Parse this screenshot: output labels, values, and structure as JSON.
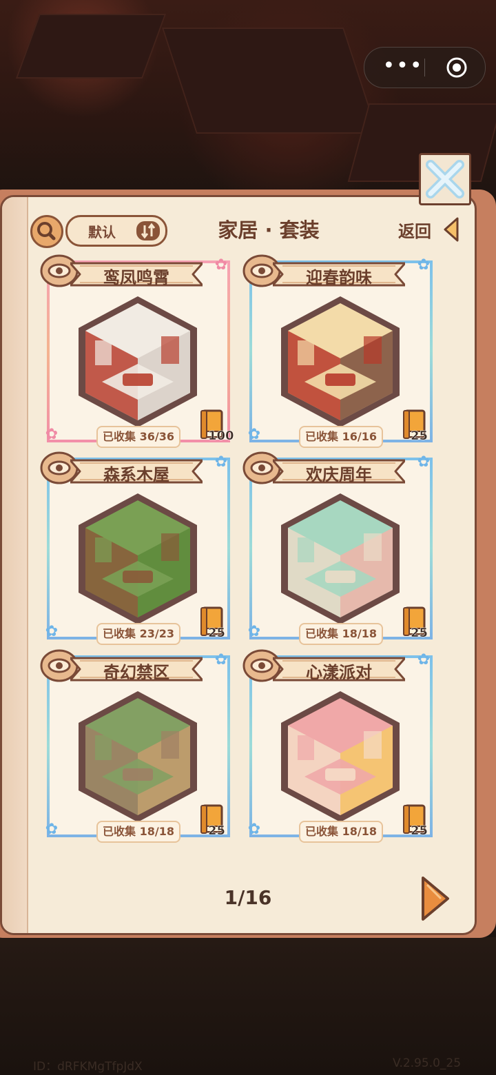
{
  "header": {
    "title": "家居 · 套装",
    "sort_label": "默认",
    "back_label": "返回"
  },
  "cards": [
    {
      "name": "鸾凤鸣霄",
      "collected": "已收集 36/36",
      "book_count": "100",
      "frame": "pink",
      "palette": [
        "#b8402f",
        "#f1ebe3",
        "#d8cfc7"
      ]
    },
    {
      "name": "迎春韵味",
      "collected": "已收集 16/16",
      "book_count": "25",
      "frame": "blue",
      "palette": [
        "#b73a2b",
        "#f3dba9",
        "#7a4e3c"
      ]
    },
    {
      "name": "森系木屋",
      "collected": "已收集 23/23",
      "book_count": "25",
      "frame": "blue",
      "palette": [
        "#8a5a39",
        "#7aa054",
        "#5d8a3b"
      ]
    },
    {
      "name": "欢庆周年",
      "collected": "已收集 18/18",
      "book_count": "25",
      "frame": "blue",
      "palette": [
        "#eadbc7",
        "#a7d7c0",
        "#f1b4a8"
      ]
    },
    {
      "name": "奇幻禁区",
      "collected": "已收集 18/18",
      "book_count": "25",
      "frame": "blue",
      "palette": [
        "#9f8064",
        "#83a063",
        "#c79b6d"
      ]
    },
    {
      "name": "心漾派对",
      "collected": "已收集 18/18",
      "book_count": "25",
      "frame": "blue",
      "palette": [
        "#f5dcc6",
        "#f0a8a8",
        "#f6c96a"
      ]
    }
  ],
  "pagination": {
    "current_label": "1/16"
  },
  "footer": {
    "id_text": "ID：dRFKMgTfpJdX",
    "version_text": "V.2.95.0_25"
  },
  "colors": {
    "panel_bg": "#f6ebd8",
    "border_brown": "#7a4a37",
    "accent_orange": "#e8a86b"
  }
}
